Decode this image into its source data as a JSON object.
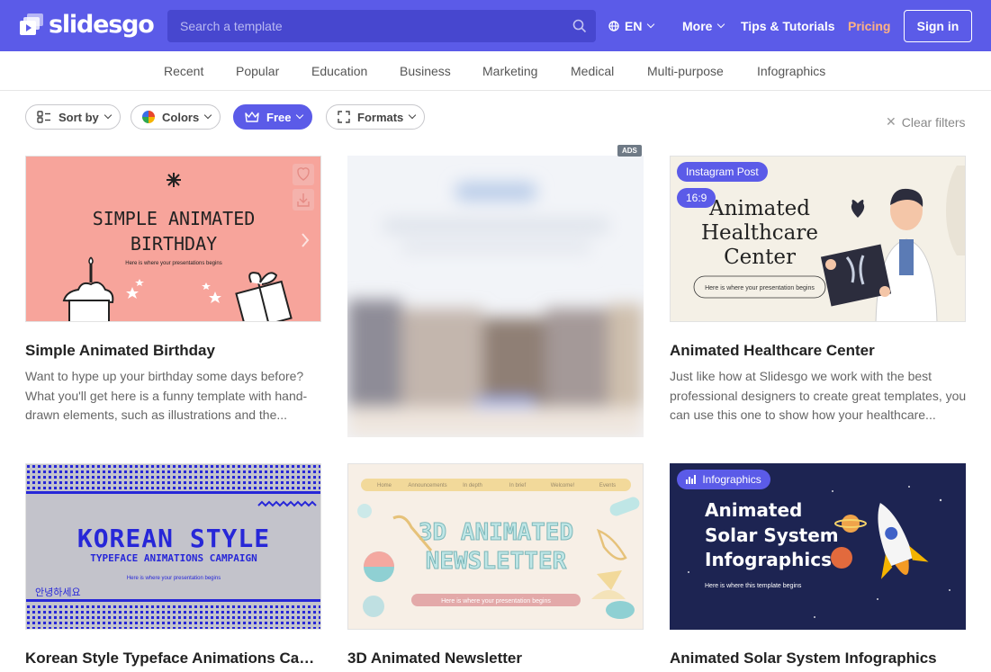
{
  "header": {
    "logo_text": "slidesgo",
    "search_placeholder": "Search a template",
    "language": "EN",
    "more": "More",
    "tips": "Tips & Tutorials",
    "pricing": "Pricing",
    "signin": "Sign in"
  },
  "categories": [
    "Recent",
    "Popular",
    "Education",
    "Business",
    "Marketing",
    "Medical",
    "Multi-purpose",
    "Infographics"
  ],
  "filters": {
    "sort": "Sort by",
    "colors": "Colors",
    "free": "Free",
    "formats": "Formats",
    "clear": "Clear filters"
  },
  "ads_badge": "ADS",
  "cards": [
    {
      "title": "Simple Animated Birthday",
      "description": "Want to hype up your birthday some days before? What you'll get here is a funny template with hand-drawn elements, such as illustrations and the...",
      "thumb_title_1": "SIMPLE ANIMATED",
      "thumb_title_2": "BIRTHDAY",
      "thumb_sub": "Here is where your presentations begins"
    },
    {
      "title": "Animated Healthcare Center",
      "description": "Just like how at Slidesgo we work with the best professional designers to create great templates, you can use this one to show how your healthcare...",
      "tag1": "Instagram Post",
      "tag2": "16:9",
      "thumb_title_1": "Animated",
      "thumb_title_2": "Healthcare",
      "thumb_title_3": "Center",
      "thumb_sub": "Here is where your presentation begins"
    },
    {
      "title": "Korean Style Typeface Animations Campaign",
      "thumb_title_1": "KOREAN STYLE",
      "thumb_title_2": "TYPEFACE ANIMATIONS CAMPAIGN",
      "thumb_sub": "Here is where your presentation begins",
      "thumb_korean": "안녕하세요"
    },
    {
      "title": "3D Animated Newsletter",
      "thumb_nav": [
        "Home",
        "Announcements",
        "In depth",
        "In brief",
        "Welcome!",
        "Events"
      ],
      "thumb_title_1": "3D ANIMATED",
      "thumb_title_2": "NEWSLETTER",
      "thumb_sub": "Here is where your presentation begins"
    },
    {
      "title": "Animated Solar System Infographics",
      "tag": "Infographics",
      "thumb_title_1": "Animated",
      "thumb_title_2": "Solar System",
      "thumb_title_3": "Infographics",
      "thumb_sub": "Here is where this template begins"
    }
  ],
  "colors": {
    "brand": "#5b5be8",
    "pricing": "#ffb184",
    "birthday_bg": "#f7a49b",
    "health_bg": "#f4f0e6",
    "korean_bg": "#c3c3cb",
    "korean_blue": "#2727d8",
    "newsletter_bg": "#f7efe6",
    "solar_bg": "#1d2452"
  }
}
